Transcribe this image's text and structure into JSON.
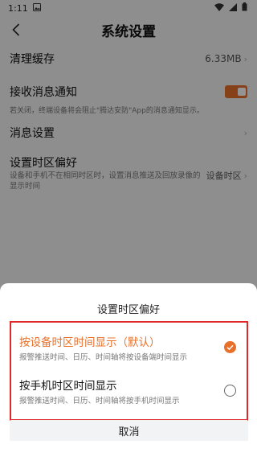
{
  "status_bar": {
    "time": "1:11"
  },
  "header": {
    "title": "系统设置"
  },
  "settings": {
    "cache": {
      "label": "清理缓存",
      "value": "6.33MB"
    },
    "notify": {
      "label": "接收消息通知",
      "enabled": true,
      "hint": "若关闭，终端设备将会阻止\"腾达安防\"App的消息通知显示。"
    },
    "messages": {
      "label": "消息设置"
    },
    "timezone": {
      "label": "设置时区偏好",
      "hint": "设备和手机不在相同时区时，设置消息推送及回放录像的显示时间",
      "value": "设备时区"
    }
  },
  "sheet": {
    "title": "设置时区偏好",
    "options": [
      {
        "title": "按设备时区时间显示（默认）",
        "subtitle": "报警推送时间、日历、时间轴将按设备端时间显示",
        "selected": true
      },
      {
        "title": "按手机时区时间显示",
        "subtitle": "报警推送时间、日历、时间轴将按手机时间显示",
        "selected": false
      }
    ],
    "cancel_label": "取消"
  },
  "colors": {
    "accent": "#e8702a",
    "highlight": "#e02a2a"
  }
}
